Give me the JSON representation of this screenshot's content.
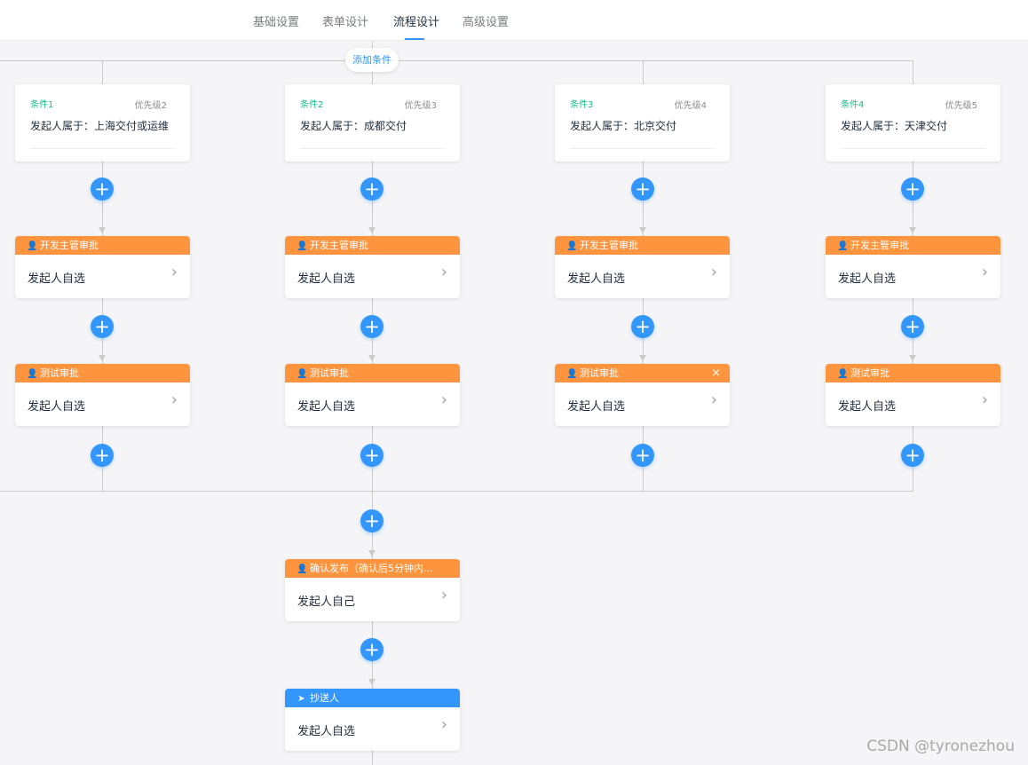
{
  "tabs": [
    {
      "label": "基础设置",
      "active": false
    },
    {
      "label": "表单设计",
      "active": false
    },
    {
      "label": "流程设计",
      "active": true
    },
    {
      "label": "高级设置",
      "active": false
    }
  ],
  "add_condition_label": "添加条件",
  "branches": [
    {
      "condition": {
        "title": "条件1",
        "priority": "优先级2",
        "content": "发起人属于：上海交付或运维"
      },
      "nodes": [
        {
          "title": "开发主管审批",
          "content": "发起人自选",
          "icon": "user-icon"
        },
        {
          "title": "测试审批",
          "content": "发起人自选",
          "icon": "user-icon"
        }
      ]
    },
    {
      "condition": {
        "title": "条件2",
        "priority": "优先级3",
        "content": "发起人属于：成都交付"
      },
      "nodes": [
        {
          "title": "开发主管审批",
          "content": "发起人自选",
          "icon": "user-icon"
        },
        {
          "title": "测试审批",
          "content": "发起人自选",
          "icon": "user-icon"
        }
      ]
    },
    {
      "condition": {
        "title": "条件3",
        "priority": "优先级4",
        "content": "发起人属于：北京交付"
      },
      "nodes": [
        {
          "title": "开发主管审批",
          "content": "发起人自选",
          "icon": "user-icon"
        },
        {
          "title": "测试审批",
          "content": "发起人自选",
          "icon": "user-icon",
          "close_icon": "×"
        }
      ]
    },
    {
      "condition": {
        "title": "条件4",
        "priority": "优先级5",
        "content": "发起人属于：天津交付"
      },
      "nodes": [
        {
          "title": "开发主管审批",
          "content": "发起人自选",
          "icon": "user-icon"
        },
        {
          "title": "测试审批",
          "content": "发起人自选",
          "icon": "user-icon"
        }
      ]
    }
  ],
  "main_nodes": [
    {
      "title": "确认发布（确认后5分钟内...",
      "content": "发起人自己",
      "icon": "user-icon",
      "color": "#ff943e"
    },
    {
      "title": "抄送人",
      "content": "发起人自选",
      "icon": "send-icon",
      "color": "#3296fa"
    }
  ],
  "add_node_symbol": "+",
  "chevron_symbol": "›",
  "watermark": "CSDN @tyronezhou",
  "colors": {
    "accent": "#3296fa",
    "approver": "#ff943e",
    "condition_title": "#15bc83"
  }
}
